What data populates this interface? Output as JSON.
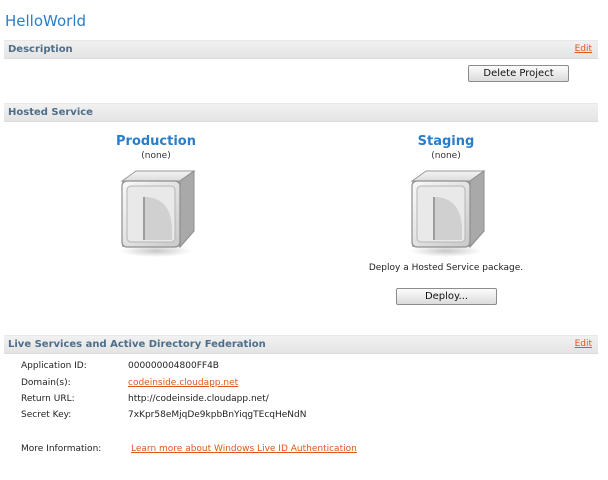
{
  "page": {
    "title": "HelloWorld"
  },
  "description": {
    "section_title": "Description",
    "edit_label": "Edit",
    "delete_button": "Delete Project"
  },
  "hosted_service": {
    "section_title": "Hosted Service",
    "production": {
      "title": "Production",
      "state": "(none)"
    },
    "staging": {
      "title": "Staging",
      "state": "(none)"
    },
    "deploy_text": "Deploy a Hosted Service package.",
    "deploy_button": "Deploy..."
  },
  "live_services": {
    "section_title": "Live Services and Active Directory Federation",
    "edit_label": "Edit",
    "fields": [
      {
        "label": "Application ID:",
        "value": "000000004800FF4B"
      },
      {
        "label": "Domain(s):",
        "value": "codeinside.cloudapp.net"
      },
      {
        "label": "Return URL:",
        "value": "http://codeinside.cloudapp.net/"
      },
      {
        "label": "Secret Key:",
        "value": "7xKpr58eMjqDe9kpbBnYiqgTEcqHeNdN"
      }
    ],
    "more_info": {
      "label": "More Information:",
      "link": "Learn more about Windows Live ID Authentication"
    }
  },
  "colors": {
    "title_blue": "#2a7ec9",
    "link_orange": "#e0571d",
    "section_text": "#4d6e8a"
  }
}
